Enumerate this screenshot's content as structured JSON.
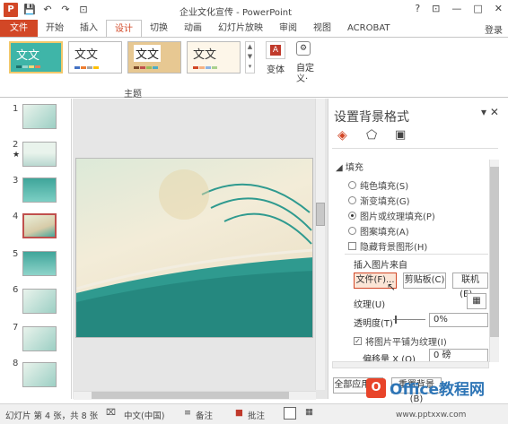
{
  "app": {
    "title": "企业文化宣传 - PowerPoint",
    "login": "登录"
  },
  "qat": {
    "save": "💾",
    "undo": "↶",
    "redo": "↷",
    "extra": "⊡"
  },
  "window": {
    "help": "?",
    "restore": "⊡",
    "minimize": "—",
    "maximize": "□",
    "close": "✕"
  },
  "tabs": [
    "文件",
    "开始",
    "插入",
    "设计",
    "切换",
    "动画",
    "幻灯片放映",
    "审阅",
    "视图",
    "ACROBAT"
  ],
  "ribbon": {
    "theme_sample": "文文",
    "group_label": "主题",
    "variant_label": "变体",
    "customize_label1": "自定",
    "customize_label2": "义·"
  },
  "slides": [
    "1",
    "2",
    "3",
    "4",
    "5",
    "6",
    "7",
    "8"
  ],
  "pane": {
    "title": "设置背景格式",
    "section": "填充",
    "options": [
      "纯色填充(S)",
      "渐变填充(G)",
      "图片或纹理填充(P)",
      "图案填充(A)"
    ],
    "hide_bg": "隐藏背景图形(H)",
    "insert_from": "插入图片来自",
    "file_btn": "文件(F)...",
    "clipboard_btn": "剪贴板(C)",
    "online_btn": "联机(E)...",
    "texture_label": "纹理(U)",
    "transparency_label": "透明度(T)",
    "transparency_value": "0%",
    "tile_label": "将图片平铺为纹理(I)",
    "offset_label": "偏移量 X (O)",
    "offset_value": "0 磅",
    "apply_all": "全部应用(L)",
    "reset_bg": "重置背景(B)"
  },
  "status": {
    "slide_info": "幻灯片 第 4 张，共 8 张",
    "language": "中文(中国)",
    "notes": "备注",
    "comments": "批注"
  },
  "watermark": {
    "brand": "Office教程网",
    "url": "www.pptxxw.com"
  }
}
